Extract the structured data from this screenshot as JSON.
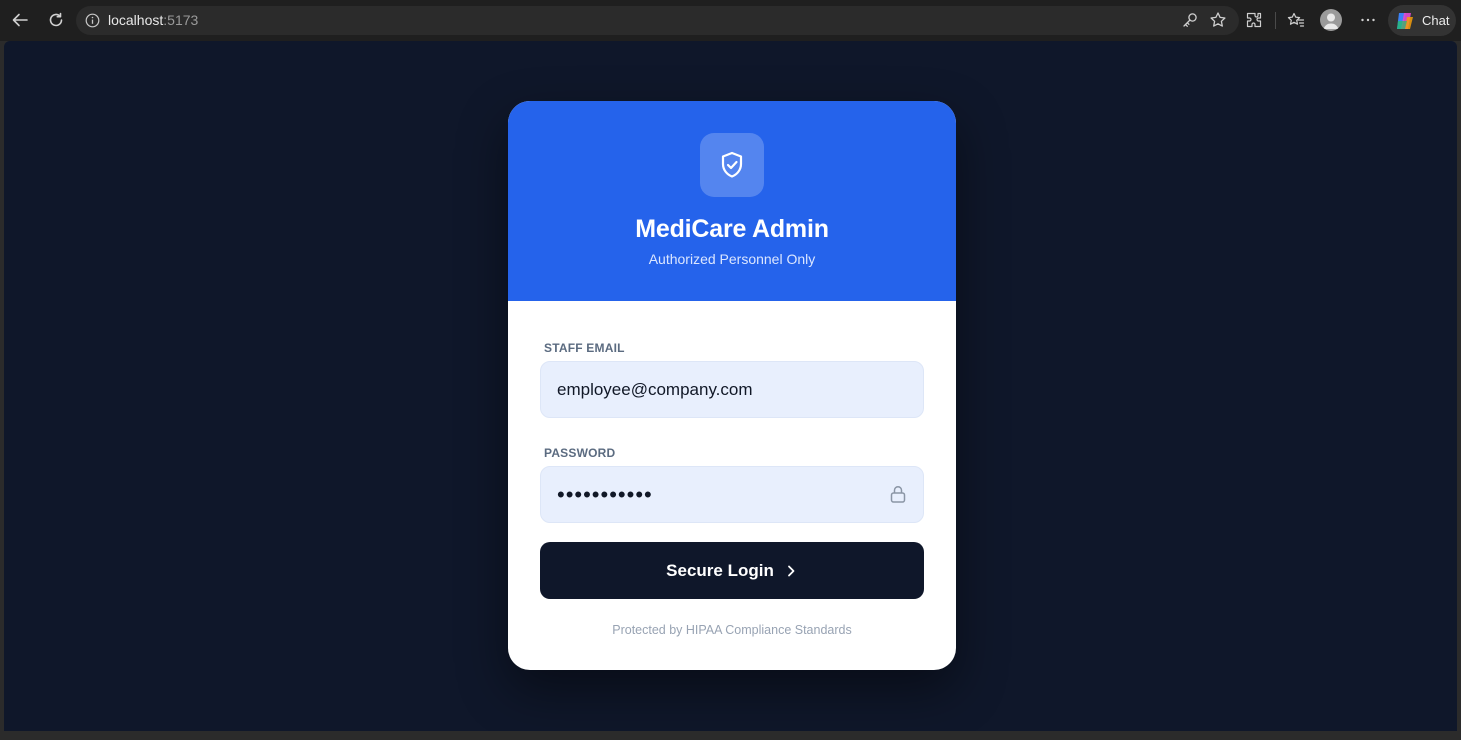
{
  "browser": {
    "url_host": "localhost",
    "url_port": ":5173",
    "chat_label": "Chat"
  },
  "login": {
    "title": "MediCare Admin",
    "subtitle": "Authorized Personnel Only",
    "email_label": "STAFF EMAIL",
    "email_value": "employee@company.com",
    "password_label": "PASSWORD",
    "password_value": "•••••••••••",
    "submit_label": "Secure Login",
    "footer": "Protected by HIPAA Compliance Standards"
  },
  "colors": {
    "page_background": "#0f172a",
    "header_blue": "#2563eb",
    "button_dark": "#0f172a",
    "input_background": "#e8effd"
  },
  "icons": [
    "back-icon",
    "reload-icon",
    "info-icon",
    "key-icon",
    "star-icon",
    "extensions-icon",
    "favorites-icon",
    "profile-icon",
    "more-icon",
    "copilot-icon",
    "shield-check-icon",
    "lock-icon",
    "chevron-right-icon"
  ]
}
